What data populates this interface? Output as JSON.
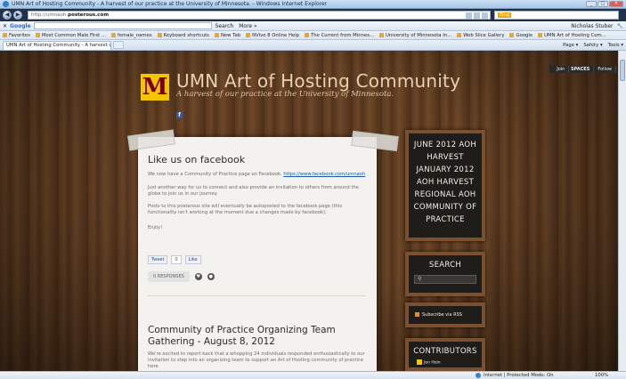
{
  "browser": {
    "window_title": "UMN Art of Hosting Community - A harvest of our practice at the University of Minnesota. - Windows Internet Explorer",
    "url_prefix": "http://umnaoh.",
    "url_domain": "posterous.com",
    "search_engine": "Bing",
    "google": {
      "logo": "Google",
      "search_label": "Search",
      "more_label": "More »",
      "user": "Nicholas Stuber"
    },
    "favorites": [
      "Favorites",
      "Most Common Male First ...",
      "female_names",
      "Keyboard shortcuts",
      "New Tab",
      "NVivo 8 Online Help",
      "The Current from Minnes...",
      "University of Minnesota In...",
      "Web Slice Gallery",
      "Google",
      "UMN Art of Hosting Com..."
    ],
    "tab_label": "UMN Art of Hosting Community - A harvest of o...",
    "tools": [
      "Page ▾",
      "Safety ▾",
      "Tools ▾"
    ],
    "status": {
      "zone": "Internet | Protected Mode: On",
      "zoom": "100%"
    }
  },
  "site": {
    "join_label": "Join",
    "spaces_label": "SPACES",
    "follow_label": "Follow",
    "logo_letter": "M",
    "title": "UMN Art of Hosting Community",
    "subtitle": "A harvest of our practice at the University of Minnesota.",
    "fb_badge": "f"
  },
  "posts": [
    {
      "title": "Like us on facebook",
      "p1_text": "We now have a Community of Practice page on Facebook.",
      "p1_link": "https://www.facebook.com/umnaoh",
      "p2": "Just another way for us to connect and also provide an invitation to others from around the globe to join us in our journey.",
      "p3": "Posts to this posterous site will eventually be autoposted to the facebook page (this functionality isn't working at the moment due a changes made by facebook).",
      "p4": "Enjoy!",
      "tweet": "Tweet",
      "tweet_count": "0",
      "like": "Like",
      "responses": "0 RESPONSES"
    },
    {
      "title": "Community of Practice Organizing Team Gathering - August 8, 2012",
      "p1": "We're excited to report back that a whopping 24 individuals responded enthusiastically to our invitation to step into an organizing team to support an Art of Hosting community of practice here"
    }
  ],
  "sidebar": {
    "topics": [
      "JUNE 2012 AOH",
      "HARVEST",
      "JANUARY 2012",
      "AOH HARVEST",
      "REGIONAL AOH",
      "COMMUNITY OF",
      "PRACTICE"
    ],
    "search_title": "SEARCH",
    "rss": "Subscribe via RSS",
    "contributors_title": "CONTRIBUTORS",
    "contributor": "Jen Hein"
  },
  "colors": {
    "umn_gold": "#f5c400",
    "umn_maroon": "#7a0019",
    "title_color": "#e6d2b0"
  }
}
